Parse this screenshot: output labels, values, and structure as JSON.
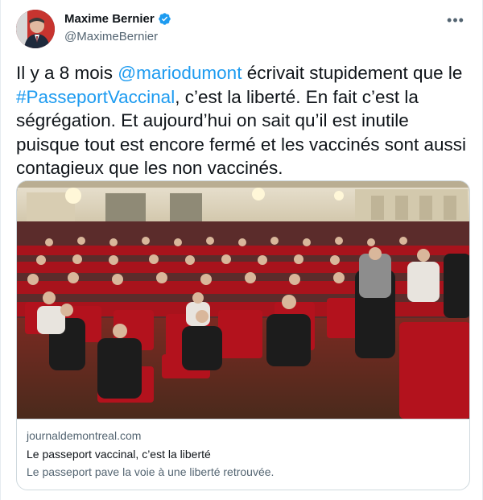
{
  "author": {
    "display_name": "Maxime Bernier",
    "handle": "@MaximeBernier",
    "verified_icon": "verified-badge-icon",
    "verified_color": "#1d9bf0"
  },
  "more_label": "•••",
  "tweet": {
    "part1": "Il y a 8 mois ",
    "mention": "@mariodumont",
    "part2": " écrivait stupidement que le ",
    "hashtag": "#PasseportVaccinal",
    "part3": ", c’est la liberté. En fait c’est la ségrégation. Et aujourd’hui on sait qu’il est inutile puisque tout est encore fermé et les vaccinés sont aussi contagieux que les non vaccinés."
  },
  "link_card": {
    "domain": "journaldemontreal.com",
    "title": "Le passeport vaccinal, c’est la liberté",
    "description": "Le passeport pave la voie à une liberté retrouvée.",
    "image_icon": "theater-audience-photo"
  },
  "colors": {
    "link": "#1d9bf0",
    "secondary_text": "#536471",
    "border": "#cfd9de",
    "seat_red": "#b3121d"
  }
}
